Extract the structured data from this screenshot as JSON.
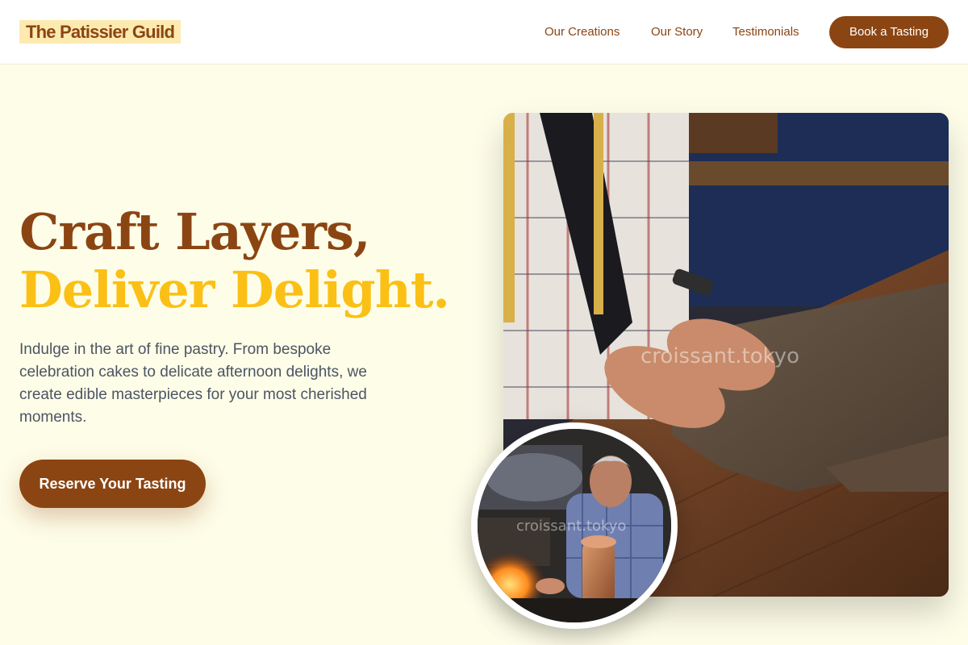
{
  "brand": {
    "name": "The Patissier Guild"
  },
  "nav": {
    "links": [
      "Our Creations",
      "Our Story",
      "Testimonials"
    ],
    "cta": "Book a Tasting"
  },
  "hero": {
    "headline_line1": "Craft Layers,",
    "headline_line2": "Deliver Delight.",
    "description": "Indulge in the art of fine pastry. From bespoke celebration cakes to delicate afternoon delights, we create edible masterpieces for your most cherished moments.",
    "cta": "Reserve Your Tasting"
  },
  "images": {
    "watermark": "croissant.tokyo"
  },
  "colors": {
    "brand_brown": "#8b4513",
    "accent_yellow": "#fbc015",
    "background_cream": "#fefde8"
  }
}
